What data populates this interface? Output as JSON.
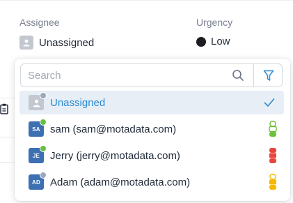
{
  "form": {
    "assignee_label": "Assignee",
    "assignee_value": "Unassigned",
    "urgency_label": "Urgency",
    "urgency_value": "Low"
  },
  "dropdown": {
    "search_placeholder": "Search",
    "items": [
      {
        "label": "Unassigned",
        "avatar_text": "",
        "avatar_color": "#c3c7cf",
        "status_color": "#9aa8bd",
        "selected": true
      },
      {
        "label": "sam (sam@motadata.com)",
        "avatar_text": "SA",
        "avatar_color": "#3d6fb3",
        "status_color": "#67bf3f",
        "level_color": "#6bbf3b",
        "level_fill": "low"
      },
      {
        "label": "Jerry (jerry@motadata.com)",
        "avatar_text": "JE",
        "avatar_color": "#3d6fb3",
        "status_color": "#67bf3f",
        "level_color": "#e8453c",
        "level_fill": "high"
      },
      {
        "label": "Adam (adam@motadata.com)",
        "avatar_text": "AD",
        "avatar_color": "#3d6fb3",
        "status_color": "#9aa8bd",
        "level_color": "#f5b800",
        "level_fill": "medium"
      }
    ]
  },
  "colors": {
    "accent": "#2a8ad2",
    "selected_bg": "#e7eef6"
  },
  "icons": {
    "search": "search-icon",
    "filter": "filter-icon",
    "check": "check-icon",
    "user": "user-icon",
    "clipboard": "clipboard-icon"
  }
}
